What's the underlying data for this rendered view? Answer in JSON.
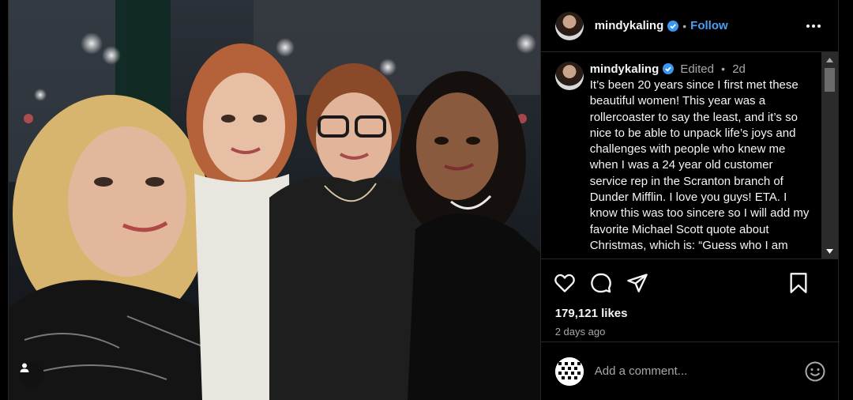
{
  "post": {
    "username": "mindykaling",
    "verified": true,
    "follow_label": "Follow",
    "separator": "•",
    "caption_edited": "Edited",
    "caption_age": "2d",
    "caption_text": "It’s been 20 years since I first met these beautiful women! This year was a rollercoaster to say the least, and it’s so nice to be able to unpack life’s joys and challenges with people who knew me when I was a 24 year old customer service rep in the Scranton branch of Dunder Mifflin. I love you guys! ETA. I know this was too sincere so I will add my favorite Michael Scott quote about Christmas, which is: “Guess who I am",
    "likes": "179,121 likes",
    "posted_ago": "2 days ago",
    "comment_placeholder": "Add a comment..."
  },
  "colors": {
    "accent": "#4a9ff5",
    "verified": "#3897f0",
    "panel_bg": "#000000",
    "border": "#262626",
    "muted_text": "#a8a8a8"
  },
  "icons": {
    "more": "more-options-icon",
    "like": "heart-icon",
    "comment": "comment-icon",
    "share": "share-icon",
    "save": "bookmark-icon",
    "emoji": "emoji-icon",
    "tag": "user-tag-icon"
  }
}
